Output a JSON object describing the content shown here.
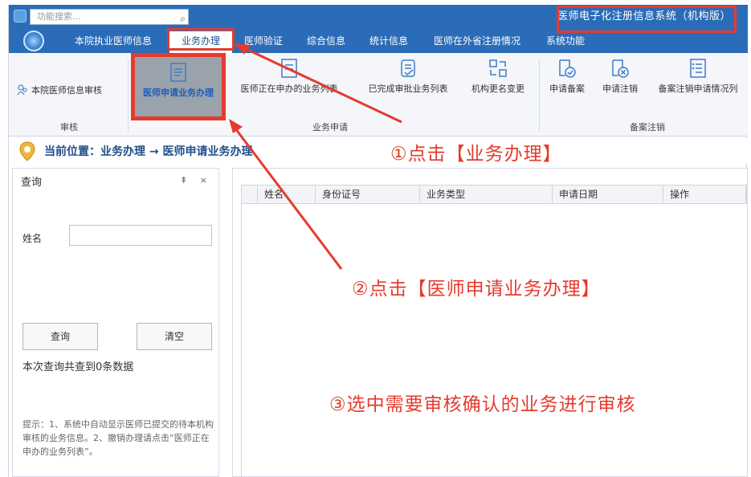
{
  "titlebar": {
    "search_placeholder": "功能搜索...",
    "search_icon": "search-icon",
    "app_title": "医师电子化注册信息系统（机构版）"
  },
  "menu": {
    "items": [
      {
        "label": "本院执业医师信息"
      },
      {
        "label": "业务办理"
      },
      {
        "label": "医师验证"
      },
      {
        "label": "综合信息"
      },
      {
        "label": "统计信息"
      },
      {
        "label": "医师在外省注册情况"
      },
      {
        "label": "系统功能"
      }
    ],
    "active_index": 1
  },
  "ribbon": {
    "audit_group": {
      "label": "审核",
      "button": "本院医师信息审核"
    },
    "apply_group": {
      "label": "业务申请",
      "buttons": [
        {
          "label": "医师申请业务办理",
          "icon": "document-edit-icon"
        },
        {
          "label": "医师正在申办的业务列表",
          "icon": "document-list-icon"
        },
        {
          "label": "已完成审批业务列表",
          "icon": "document-check-icon"
        },
        {
          "label": "机构更名变更",
          "icon": "rename-icon"
        }
      ]
    },
    "record_group": {
      "label": "备案注销",
      "buttons": [
        {
          "label": "申请备案",
          "icon": "record-check-icon"
        },
        {
          "label": "申请注销",
          "icon": "record-cancel-icon"
        },
        {
          "label": "备案注销申请情况列",
          "icon": "checklist-icon"
        }
      ]
    }
  },
  "location": {
    "text": "当前位置：业务办理 → 医师申请业务办理"
  },
  "query": {
    "title": "查询",
    "tools": "⇞ ×",
    "name_label": "姓名",
    "name_value": "",
    "search_button": "查询",
    "clear_button": "清空",
    "result_text": "本次查询共查到0条数据",
    "hint": "提示：1、系统中自动显示医师已提交的待本机构审核的业务信息。2、撤销办理请点击“医师正在申办的业务列表”。"
  },
  "grid": {
    "columns": [
      "姓名",
      "身份证号",
      "业务类型",
      "申请日期",
      "操作"
    ]
  },
  "annotations": {
    "step1": "①点击【业务办理】",
    "step2": "②点击【医师申请业务办理】",
    "step3": "③选中需要审核确认的业务进行审核",
    "color": "#e53b2e"
  },
  "colors": {
    "header_blue": "#2b6cb8",
    "accent_red": "#e53b2e",
    "link_blue": "#1f4e8a"
  }
}
